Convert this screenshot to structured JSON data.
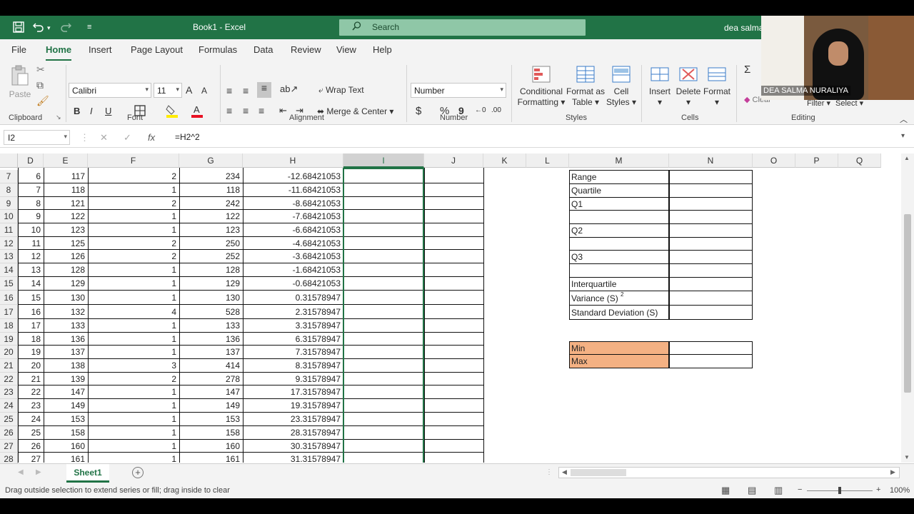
{
  "window": {
    "doc_title": "Book1 - Excel",
    "search_placeholder": "Search",
    "user": "dea salma"
  },
  "tabs": [
    "File",
    "Home",
    "Insert",
    "Page Layout",
    "Formulas",
    "Data",
    "Review",
    "View",
    "Help"
  ],
  "ribbon": {
    "clipboard": {
      "paste": "Paste",
      "label": "Clipboard"
    },
    "font": {
      "name": "Calibri",
      "size": "11",
      "bold": "B",
      "italic": "I",
      "underline": "U",
      "grow": "A",
      "shrink": "A",
      "label": "Font"
    },
    "alignment": {
      "wrap": "Wrap Text",
      "merge": "Merge & Center",
      "label": "Alignment"
    },
    "number": {
      "format": "Number",
      "currency": "$",
      "percent": "%",
      "comma": "9",
      "label": "Number"
    },
    "styles": {
      "conditional_1": "Conditional",
      "conditional_2": "Formatting",
      "format_table_1": "Format as",
      "format_table_2": "Table",
      "cell_styles_1": "Cell",
      "cell_styles_2": "Styles",
      "label": "Styles"
    },
    "cells": {
      "insert": "Insert",
      "delete": "Delete",
      "format": "Format",
      "label": "Cells"
    },
    "editing": {
      "clear": "Clear",
      "filter": "Filter",
      "select": "Select",
      "label": "Editing"
    }
  },
  "formula_bar": {
    "name_box": "I2",
    "fx": "fx",
    "formula": "=H2^2"
  },
  "columns": [
    "D",
    "E",
    "F",
    "G",
    "H",
    "I",
    "J",
    "K",
    "L",
    "M",
    "N",
    "O",
    "P",
    "Q"
  ],
  "rows": [
    {
      "r": "7",
      "d": "6",
      "e": "117",
      "f": "2",
      "g": "234",
      "h": "-12.68421053"
    },
    {
      "r": "8",
      "d": "7",
      "e": "118",
      "f": "1",
      "g": "118",
      "h": "-11.68421053"
    },
    {
      "r": "9",
      "d": "8",
      "e": "121",
      "f": "2",
      "g": "242",
      "h": "-8.68421053"
    },
    {
      "r": "10",
      "d": "9",
      "e": "122",
      "f": "1",
      "g": "122",
      "h": "-7.68421053"
    },
    {
      "r": "11",
      "d": "10",
      "e": "123",
      "f": "1",
      "g": "123",
      "h": "-6.68421053"
    },
    {
      "r": "12",
      "d": "11",
      "e": "125",
      "f": "2",
      "g": "250",
      "h": "-4.68421053"
    },
    {
      "r": "13",
      "d": "12",
      "e": "126",
      "f": "2",
      "g": "252",
      "h": "-3.68421053"
    },
    {
      "r": "14",
      "d": "13",
      "e": "128",
      "f": "1",
      "g": "128",
      "h": "-1.68421053"
    },
    {
      "r": "15",
      "d": "14",
      "e": "129",
      "f": "1",
      "g": "129",
      "h": "-0.68421053"
    },
    {
      "r": "16",
      "d": "15",
      "e": "130",
      "f": "1",
      "g": "130",
      "h": "0.31578947"
    },
    {
      "r": "17",
      "d": "16",
      "e": "132",
      "f": "4",
      "g": "528",
      "h": "2.31578947"
    },
    {
      "r": "18",
      "d": "17",
      "e": "133",
      "f": "1",
      "g": "133",
      "h": "3.31578947"
    },
    {
      "r": "19",
      "d": "18",
      "e": "136",
      "f": "1",
      "g": "136",
      "h": "6.31578947"
    },
    {
      "r": "20",
      "d": "19",
      "e": "137",
      "f": "1",
      "g": "137",
      "h": "7.31578947"
    },
    {
      "r": "21",
      "d": "20",
      "e": "138",
      "f": "3",
      "g": "414",
      "h": "8.31578947"
    },
    {
      "r": "22",
      "d": "21",
      "e": "139",
      "f": "2",
      "g": "278",
      "h": "9.31578947"
    },
    {
      "r": "23",
      "d": "22",
      "e": "147",
      "f": "1",
      "g": "147",
      "h": "17.31578947"
    },
    {
      "r": "24",
      "d": "23",
      "e": "149",
      "f": "1",
      "g": "149",
      "h": "19.31578947"
    },
    {
      "r": "25",
      "d": "24",
      "e": "153",
      "f": "1",
      "g": "153",
      "h": "23.31578947"
    },
    {
      "r": "26",
      "d": "25",
      "e": "158",
      "f": "1",
      "g": "158",
      "h": "28.31578947"
    },
    {
      "r": "27",
      "d": "26",
      "e": "160",
      "f": "1",
      "g": "160",
      "h": "30.31578947"
    },
    {
      "r": "28",
      "d": "27",
      "e": "161",
      "f": "1",
      "g": "161",
      "h": "31.31578947"
    }
  ],
  "stats_labels": {
    "range": "Range",
    "quartile": "Quartile",
    "q1": "Q1",
    "q2": "Q2",
    "q3": "Q3",
    "interquartile": "Interquartile",
    "variance": "Variance (S)",
    "variance_sup": "2",
    "stdev": "Standard Deviation (S)",
    "min": "Min",
    "max": "Max"
  },
  "sheet": {
    "name": "Sheet1",
    "add": "+"
  },
  "status": {
    "message": "Drag outside selection to extend series or fill; drag inside to clear",
    "zoom": "100%",
    "minus": "−",
    "plus": "+"
  },
  "webcam": {
    "name": "DEA SALMA NURALIYA"
  },
  "colors": {
    "excel_green": "#217346",
    "min_max_fill": "#f4b183"
  }
}
